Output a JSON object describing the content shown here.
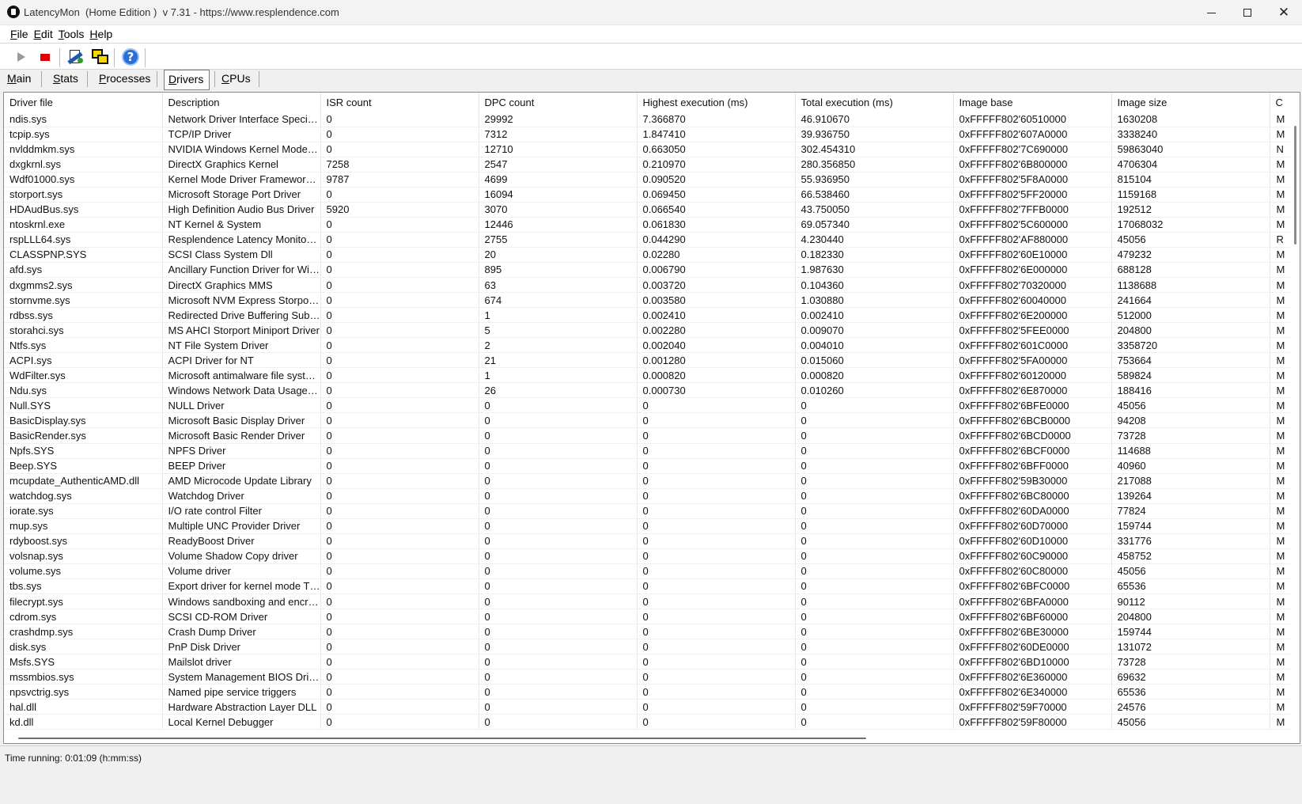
{
  "window": {
    "title": "LatencyMon  (Home Edition )  v 7.31 - https://www.resplendence.com"
  },
  "menu": [
    {
      "label": "File"
    },
    {
      "label": "Edit"
    },
    {
      "label": "Tools"
    },
    {
      "label": "Help"
    }
  ],
  "toolbar": {
    "icons": [
      "play-icon",
      "stop-icon",
      "report-icon",
      "windows-icon",
      "help-icon"
    ],
    "stop_color": "#e10000"
  },
  "tabs": [
    {
      "label": "Main"
    },
    {
      "label": "Stats"
    },
    {
      "label": "Processes"
    },
    {
      "label": "Drivers",
      "active": true
    },
    {
      "label": "CPUs"
    }
  ],
  "table": {
    "columns": [
      "Driver file",
      "Description",
      "ISR count",
      "DPC count",
      "Highest execution (ms)",
      "Total execution (ms)",
      "Image base",
      "Image size",
      "C"
    ],
    "rows": [
      [
        "ndis.sys",
        "Network Driver Interface Specification (NDIS)",
        "0",
        "29992",
        "7.366870",
        "46.910670",
        "0xFFFFF802'60510000",
        "1630208",
        "M"
      ],
      [
        "tcpip.sys",
        "TCP/IP Driver",
        "0",
        "7312",
        "1.847410",
        "39.936750",
        "0xFFFFF802'607A0000",
        "3338240",
        "M"
      ],
      [
        "nvlddmkm.sys",
        "NVIDIA Windows Kernel Mode Driver",
        "0",
        "12710",
        "0.663050",
        "302.454310",
        "0xFFFFF802'7C690000",
        "59863040",
        "N"
      ],
      [
        "dxgkrnl.sys",
        "DirectX Graphics Kernel",
        "7258",
        "2547",
        "0.210970",
        "280.356850",
        "0xFFFFF802'6B800000",
        "4706304",
        "M"
      ],
      [
        "Wdf01000.sys",
        "Kernel Mode Driver Framework Runtime",
        "9787",
        "4699",
        "0.090520",
        "55.936950",
        "0xFFFFF802'5F8A0000",
        "815104",
        "M"
      ],
      [
        "storport.sys",
        "Microsoft Storage Port Driver",
        "0",
        "16094",
        "0.069450",
        "66.538460",
        "0xFFFFF802'5FF20000",
        "1159168",
        "M"
      ],
      [
        "HDAudBus.sys",
        "High Definition Audio Bus Driver",
        "5920",
        "3070",
        "0.066540",
        "43.750050",
        "0xFFFFF802'7FFB0000",
        "192512",
        "M"
      ],
      [
        "ntoskrnl.exe",
        "NT Kernel & System",
        "0",
        "12446",
        "0.061830",
        "69.057340",
        "0xFFFFF802'5C600000",
        "17068032",
        "M"
      ],
      [
        "rspLLL64.sys",
        "Resplendence Latency Monitoring and Auxiliary Kernel Library",
        "0",
        "2755",
        "0.044290",
        "4.230440",
        "0xFFFFF802'AF880000",
        "45056",
        "R"
      ],
      [
        "CLASSPNP.SYS",
        "SCSI Class System Dll",
        "0",
        "20",
        "0.02280",
        "0.182330",
        "0xFFFFF802'60E10000",
        "479232",
        "M"
      ],
      [
        "afd.sys",
        "Ancillary Function Driver for WinSock",
        "0",
        "895",
        "0.006790",
        "1.987630",
        "0xFFFFF802'6E000000",
        "688128",
        "M"
      ],
      [
        "dxgmms2.sys",
        "DirectX Graphics MMS",
        "0",
        "63",
        "0.003720",
        "0.104360",
        "0xFFFFF802'70320000",
        "1138688",
        "M"
      ],
      [
        "stornvme.sys",
        "Microsoft NVM Express Storport Miniport Driver",
        "0",
        "674",
        "0.003580",
        "1.030880",
        "0xFFFFF802'60040000",
        "241664",
        "M"
      ],
      [
        "rdbss.sys",
        "Redirected Drive Buffering SubSystem Driver",
        "0",
        "1",
        "0.002410",
        "0.002410",
        "0xFFFFF802'6E200000",
        "512000",
        "M"
      ],
      [
        "storahci.sys",
        "MS AHCI Storport Miniport Driver",
        "0",
        "5",
        "0.002280",
        "0.009070",
        "0xFFFFF802'5FEE0000",
        "204800",
        "M"
      ],
      [
        "Ntfs.sys",
        "NT File System Driver",
        "0",
        "2",
        "0.002040",
        "0.004010",
        "0xFFFFF802'601C0000",
        "3358720",
        "M"
      ],
      [
        "ACPI.sys",
        "ACPI Driver for NT",
        "0",
        "21",
        "0.001280",
        "0.015060",
        "0xFFFFF802'5FA00000",
        "753664",
        "M"
      ],
      [
        "WdFilter.sys",
        "Microsoft antimalware file system filter driver",
        "0",
        "1",
        "0.000820",
        "0.000820",
        "0xFFFFF802'60120000",
        "589824",
        "M"
      ],
      [
        "Ndu.sys",
        "Windows Network Data Usage Monitoring Driver",
        "0",
        "26",
        "0.000730",
        "0.010260",
        "0xFFFFF802'6E870000",
        "188416",
        "M"
      ],
      [
        "Null.SYS",
        "NULL Driver",
        "0",
        "0",
        "0",
        "0",
        "0xFFFFF802'6BFE0000",
        "45056",
        "M"
      ],
      [
        "BasicDisplay.sys",
        "Microsoft Basic Display Driver",
        "0",
        "0",
        "0",
        "0",
        "0xFFFFF802'6BCB0000",
        "94208",
        "M"
      ],
      [
        "BasicRender.sys",
        "Microsoft Basic Render Driver",
        "0",
        "0",
        "0",
        "0",
        "0xFFFFF802'6BCD0000",
        "73728",
        "M"
      ],
      [
        "Npfs.SYS",
        "NPFS Driver",
        "0",
        "0",
        "0",
        "0",
        "0xFFFFF802'6BCF0000",
        "114688",
        "M"
      ],
      [
        "Beep.SYS",
        "BEEP Driver",
        "0",
        "0",
        "0",
        "0",
        "0xFFFFF802'6BFF0000",
        "40960",
        "M"
      ],
      [
        "mcupdate_AuthenticAMD.dll",
        "AMD Microcode Update Library",
        "0",
        "0",
        "0",
        "0",
        "0xFFFFF802'59B30000",
        "217088",
        "M"
      ],
      [
        "watchdog.sys",
        "Watchdog Driver",
        "0",
        "0",
        "0",
        "0",
        "0xFFFFF802'6BC80000",
        "139264",
        "M"
      ],
      [
        "iorate.sys",
        "I/O rate control Filter",
        "0",
        "0",
        "0",
        "0",
        "0xFFFFF802'60DA0000",
        "77824",
        "M"
      ],
      [
        "mup.sys",
        "Multiple UNC Provider Driver",
        "0",
        "0",
        "0",
        "0",
        "0xFFFFF802'60D70000",
        "159744",
        "M"
      ],
      [
        "rdyboost.sys",
        "ReadyBoost Driver",
        "0",
        "0",
        "0",
        "0",
        "0xFFFFF802'60D10000",
        "331776",
        "M"
      ],
      [
        "volsnap.sys",
        "Volume Shadow Copy driver",
        "0",
        "0",
        "0",
        "0",
        "0xFFFFF802'60C90000",
        "458752",
        "M"
      ],
      [
        "volume.sys",
        "Volume driver",
        "0",
        "0",
        "0",
        "0",
        "0xFFFFF802'60C80000",
        "45056",
        "M"
      ],
      [
        "tbs.sys",
        "Export driver for kernel mode TPM API",
        "0",
        "0",
        "0",
        "0",
        "0xFFFFF802'6BFC0000",
        "65536",
        "M"
      ],
      [
        "filecrypt.sys",
        "Windows sandboxing and encryption Filter",
        "0",
        "0",
        "0",
        "0",
        "0xFFFFF802'6BFA0000",
        "90112",
        "M"
      ],
      [
        "cdrom.sys",
        "SCSI CD-ROM Driver",
        "0",
        "0",
        "0",
        "0",
        "0xFFFFF802'6BF60000",
        "204800",
        "M"
      ],
      [
        "crashdmp.sys",
        "Crash Dump Driver",
        "0",
        "0",
        "0",
        "0",
        "0xFFFFF802'6BE30000",
        "159744",
        "M"
      ],
      [
        "disk.sys",
        "PnP Disk Driver",
        "0",
        "0",
        "0",
        "0",
        "0xFFFFF802'60DE0000",
        "131072",
        "M"
      ],
      [
        "Msfs.SYS",
        "Mailslot driver",
        "0",
        "0",
        "0",
        "0",
        "0xFFFFF802'6BD10000",
        "73728",
        "M"
      ],
      [
        "mssmbios.sys",
        "System Management BIOS Driver",
        "0",
        "0",
        "0",
        "0",
        "0xFFFFF802'6E360000",
        "69632",
        "M"
      ],
      [
        "npsvctrig.sys",
        "Named pipe service triggers",
        "0",
        "0",
        "0",
        "0",
        "0xFFFFF802'6E340000",
        "65536",
        "M"
      ],
      [
        "hal.dll",
        "Hardware Abstraction Layer DLL",
        "0",
        "0",
        "0",
        "0",
        "0xFFFFF802'59F70000",
        "24576",
        "M"
      ],
      [
        "kd.dll",
        "Local Kernel Debugger",
        "0",
        "0",
        "0",
        "0",
        "0xFFFFF802'59F80000",
        "45056",
        "M"
      ]
    ]
  },
  "status": {
    "text": "Time running: 0:01:09  (h:mm:ss)"
  }
}
